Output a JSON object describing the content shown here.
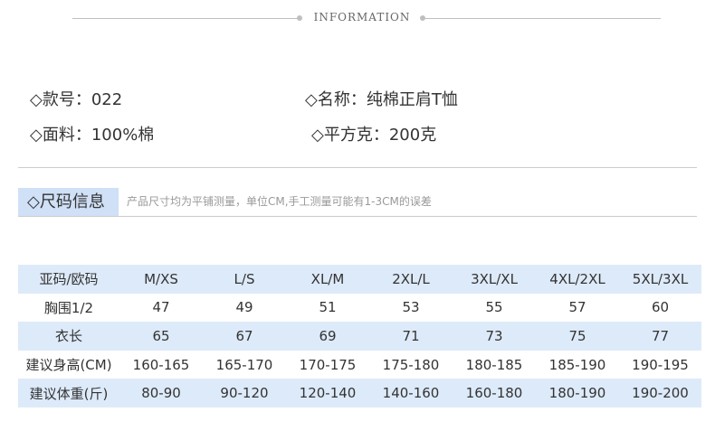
{
  "header": {
    "title": "INFORMATION"
  },
  "info": {
    "item_no": "◇款号：022",
    "name": "◇名称：纯棉正肩T恤",
    "fabric": "◇面料：100%棉",
    "weight": "◇平方克：200克"
  },
  "size_section": {
    "title": "◇尺码信息",
    "note": "产品尺寸均为平铺测量，单位CM,手工测量可能有1-3CM的误差"
  },
  "size_table": {
    "rows": [
      [
        "亚码/欧码",
        "M/XS",
        "L/S",
        "XL/M",
        "2XL/L",
        "3XL/XL",
        "4XL/2XL",
        "5XL/3XL"
      ],
      [
        "胸围1/2",
        "47",
        "49",
        "51",
        "53",
        "55",
        "57",
        "60"
      ],
      [
        "衣长",
        "65",
        "67",
        "69",
        "71",
        "73",
        "75",
        "77"
      ],
      [
        "建议身高(CM)",
        "160-165",
        "165-170",
        "170-175",
        "175-180",
        "180-185",
        "185-190",
        "190-195"
      ],
      [
        "建议体重(斤)",
        "80-90",
        "90-120",
        "120-140",
        "140-160",
        "160-180",
        "180-190",
        "190-200"
      ]
    ]
  }
}
